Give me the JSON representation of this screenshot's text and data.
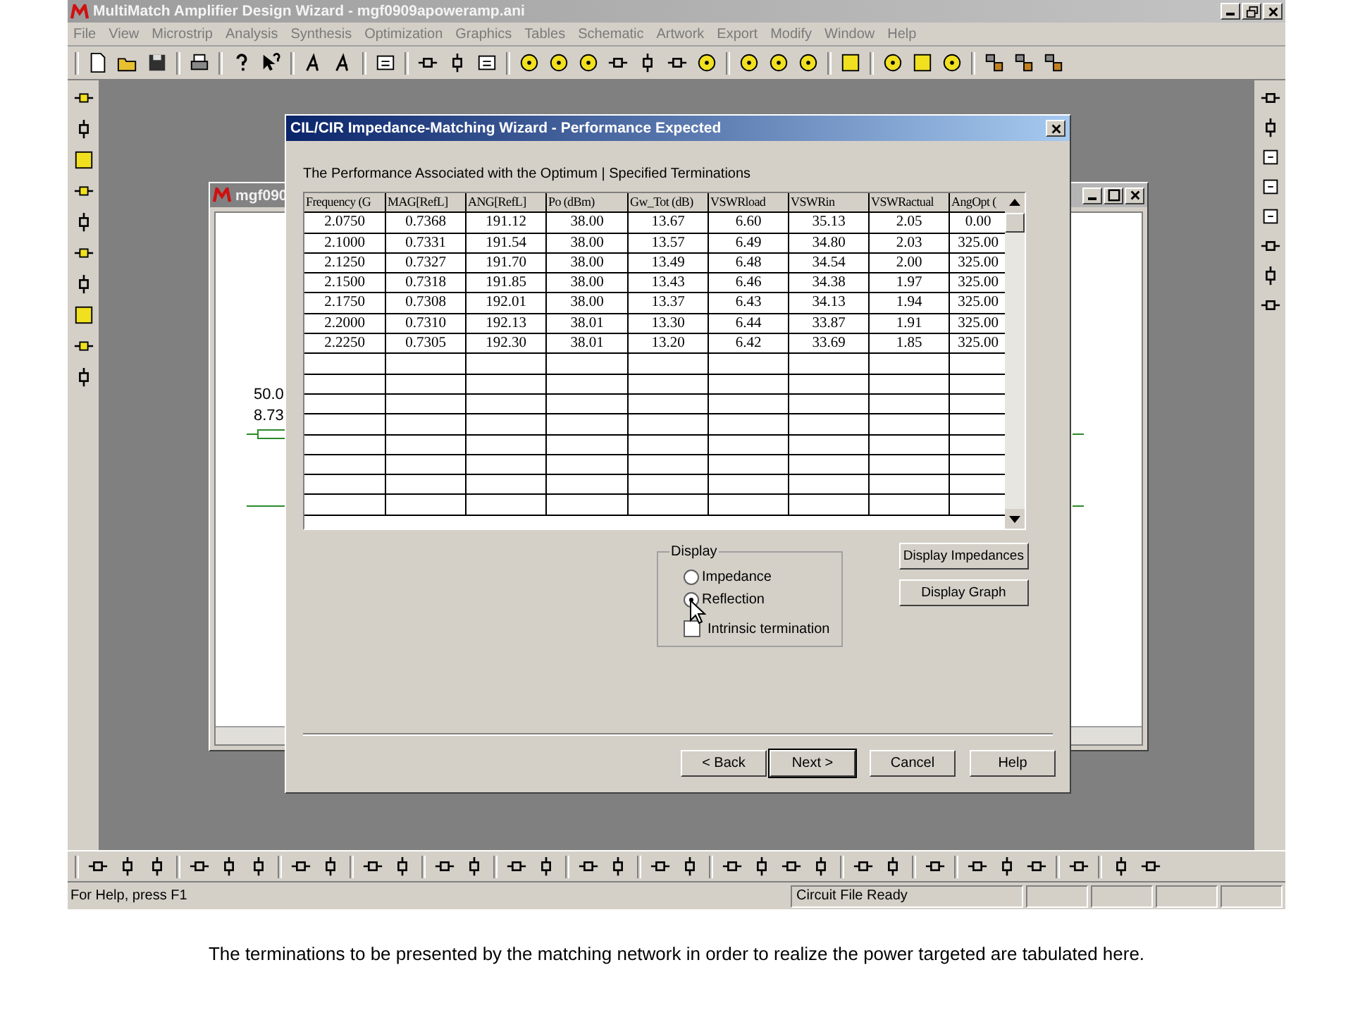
{
  "app": {
    "title": "MultiMatch Amplifier Design Wizard - mgf0909apoweramp.ani"
  },
  "menu": [
    "File",
    "View",
    "Microstrip",
    "Analysis",
    "Synthesis",
    "Optimization",
    "Graphics",
    "Tables",
    "Schematic",
    "Artwork",
    "Export",
    "Modify",
    "Window",
    "Help"
  ],
  "child_window": {
    "title": "mgf090",
    "texts": [
      "50.0",
      "8.73"
    ]
  },
  "dialog": {
    "title": "CIL/CIR Impedance-Matching Wizard - Performance Expected",
    "heading": "The Performance Associated with the Optimum | Specified Terminations",
    "table": {
      "columns": [
        "Frequency (G",
        "MAG[RefL]",
        "ANG[RefL]",
        "Po (dBm)",
        "Gw_Tot (dB)",
        "VSWRload",
        "VSWRin",
        "VSWRactual",
        "AngOpt ("
      ],
      "rows": [
        [
          "2.0750",
          "0.7368",
          "191.12",
          "38.00",
          "13.67",
          "6.60",
          "35.13",
          "2.05",
          "0.00"
        ],
        [
          "2.1000",
          "0.7331",
          "191.54",
          "38.00",
          "13.57",
          "6.49",
          "34.80",
          "2.03",
          "325.00"
        ],
        [
          "2.1250",
          "0.7327",
          "191.70",
          "38.00",
          "13.49",
          "6.48",
          "34.54",
          "2.00",
          "325.00"
        ],
        [
          "2.1500",
          "0.7318",
          "191.85",
          "38.00",
          "13.43",
          "6.46",
          "34.38",
          "1.97",
          "325.00"
        ],
        [
          "2.1750",
          "0.7308",
          "192.01",
          "38.00",
          "13.37",
          "6.43",
          "34.13",
          "1.94",
          "325.00"
        ],
        [
          "2.2000",
          "0.7310",
          "192.13",
          "38.01",
          "13.30",
          "6.44",
          "33.87",
          "1.91",
          "325.00"
        ],
        [
          "2.2250",
          "0.7305",
          "192.30",
          "38.01",
          "13.20",
          "6.42",
          "33.69",
          "1.85",
          "325.00"
        ]
      ]
    },
    "display_group": {
      "label": "Display",
      "options": [
        {
          "label": "Impedance",
          "selected": false
        },
        {
          "label": "Reflection",
          "selected": true
        }
      ],
      "checkbox": {
        "label": "Intrinsic termination",
        "checked": false
      }
    },
    "side_buttons": [
      "Display Impedances",
      "Display Graph"
    ],
    "buttons": [
      {
        "label": "< Back",
        "default": false
      },
      {
        "label": "Next >",
        "default": true
      },
      {
        "label": "Cancel",
        "default": false
      },
      {
        "label": "Help",
        "default": false
      }
    ]
  },
  "status_bar": {
    "help": "For Help, press F1",
    "state": "Circuit File Ready"
  },
  "caption": "The terminations to be presented by the matching network in order to realize the power targeted are tabulated here."
}
